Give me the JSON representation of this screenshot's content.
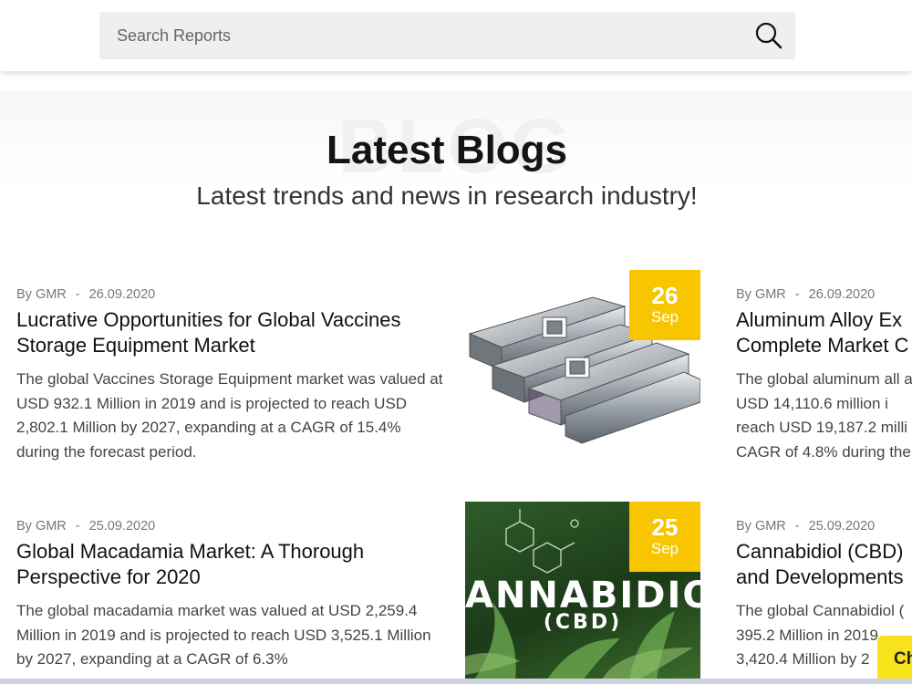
{
  "search": {
    "placeholder": "Search Reports"
  },
  "section": {
    "watermark": "BLOG",
    "title": "Latest Blogs",
    "subtitle": "Latest trends and news in research industry!"
  },
  "blogs": [
    {
      "author": "By GMR",
      "separator": "-",
      "date": "26.09.2020",
      "title": "Lucrative Opportunities for Global Vaccines Storage Equipment Market",
      "excerpt": "The global Vaccines Storage Equipment market was valued at USD 932.1 Million in 2019 and is projected to reach USD 2,802.1 Million by 2027, expanding at a CAGR of 15.4% during the forecast period.",
      "badge_day": "26",
      "badge_month": "Sep"
    },
    {
      "author": "By GMR",
      "separator": "-",
      "date": "26.09.2020",
      "title": "Aluminum Alloy Ex Complete Market C",
      "excerpt": "The global aluminum all at USD 14,110.6 million i reach USD 19,187.2 milli CAGR of 4.8% during the"
    },
    {
      "author": "By GMR",
      "separator": "-",
      "date": "25.09.2020",
      "title": "Global Macadamia Market: A Thorough Perspective for 2020",
      "excerpt": "The global macadamia market was valued at USD 2,259.4 Million in 2019 and is projected to reach USD 3,525.1 Million by 2027, expanding at a CAGR of 6.3%",
      "badge_day": "25",
      "badge_month": "Sep",
      "image_text": "ANNABIDIO",
      "image_subtext": "(CBD)"
    },
    {
      "author": "By GMR",
      "separator": "-",
      "date": "25.09.2020",
      "title": "Cannabidiol (CBD) and Developments",
      "excerpt": "The global Cannabidiol ( 395.2 Million in 2019 3,420.4 Million by 2"
    }
  ],
  "chat": {
    "label": "Ch"
  },
  "colors": {
    "badge": "#f7c600",
    "chat": "#f7e21c",
    "header_shadow": "rgba(0,0,0,0.12)"
  }
}
